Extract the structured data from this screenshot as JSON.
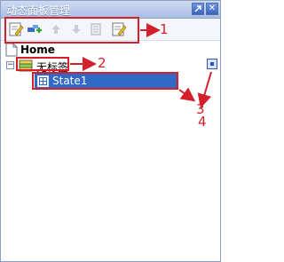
{
  "window": {
    "title": "动态面板管理",
    "pin_icon": "pin-icon",
    "close_icon": "close-icon",
    "close_glyph": "✕"
  },
  "toolbar": {
    "tools": [
      {
        "name": "edit-state-icon"
      },
      {
        "name": "add-state-icon"
      },
      {
        "name": "move-up-icon"
      },
      {
        "name": "move-down-icon"
      },
      {
        "name": "duplicate-state-icon"
      },
      {
        "name": "edit-panel-icon"
      }
    ]
  },
  "tree": {
    "home_label": "Home",
    "panel_label": "无标签",
    "panel_toggle": "−",
    "state_label": "State1"
  },
  "annotations": {
    "label_1": "1",
    "label_2": "2",
    "label_3": "3",
    "label_4": "4",
    "color": "#d4202a"
  },
  "colors": {
    "selection": "#3169c6",
    "titlebar": "#a9bde3"
  }
}
